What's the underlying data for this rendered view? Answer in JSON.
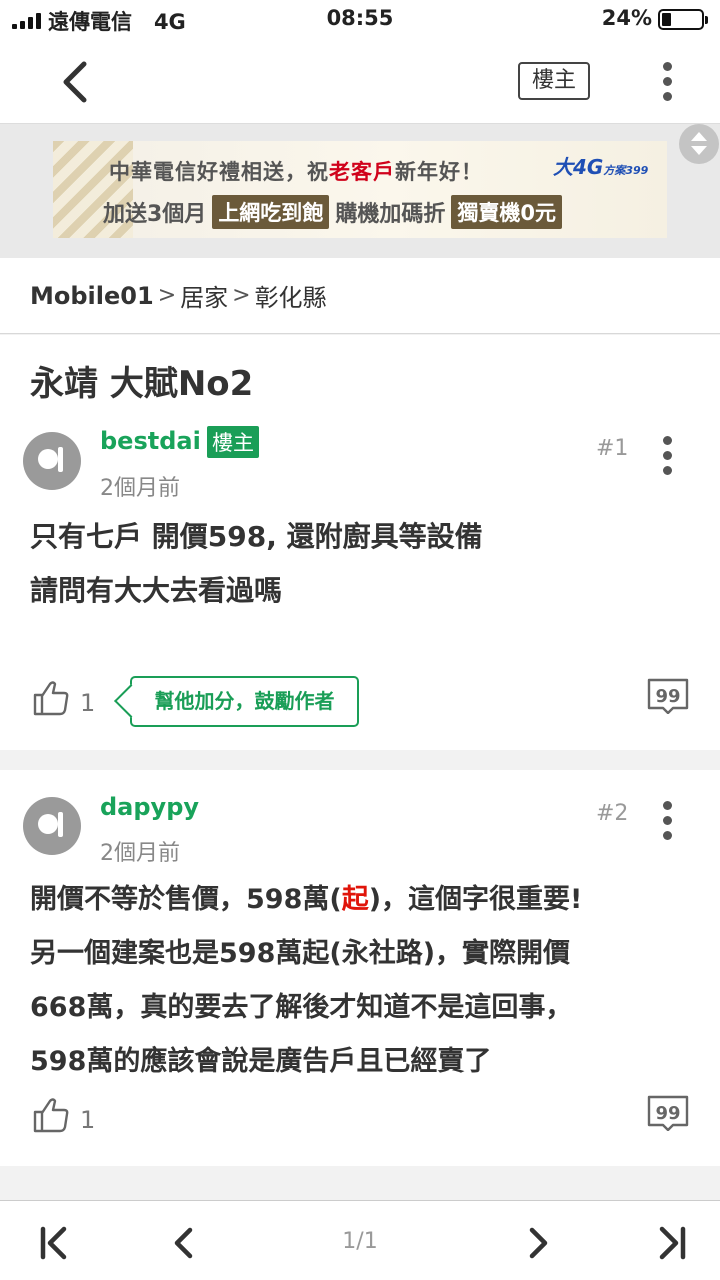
{
  "status_bar": {
    "carrier": "遠傳電信",
    "network": "4G",
    "time": "08:55",
    "battery_percent": "24%",
    "battery_level": 0.24
  },
  "nav": {
    "op_button_label": "樓主"
  },
  "ad": {
    "line1_a": "中華電信好禮相送，祝",
    "line1_red": "老客戶",
    "line1_b": "新年好！",
    "line2_a": "加送3個月",
    "line2_box1": "上網吃到飽",
    "line2_b": "購機加碼折",
    "line2_box2": "獨賣機0元",
    "brand": "大4G",
    "brand_plan": "方案399"
  },
  "breadcrumb": {
    "items": [
      "Mobile01",
      "居家",
      "彰化縣"
    ],
    "separator": ">"
  },
  "thread": {
    "title": "永靖 大賦No2"
  },
  "posts": [
    {
      "username": "bestdai",
      "op_tag": "樓主",
      "time_ago": "2個月前",
      "floor": "#1",
      "lines": [
        "只有七戶 開價598, 還附廚具等設備",
        "請問有大大去看過嗎"
      ],
      "likes": "1",
      "cheer_label": "幫他加分，鼓勵作者"
    },
    {
      "username": "dapypy",
      "time_ago": "2個月前",
      "floor": "#2",
      "line1_a": "開價不等於售價，598萬(",
      "line1_red": "起",
      "line1_b": ")，這個字很重要!",
      "lines": [
        "另一個建案也是598萬起(永社路)，實際開價",
        "668萬，真的要去了解後才知道不是這回事，",
        "598萬的應該會說是廣告戶且已經賣了"
      ],
      "likes": "1"
    }
  ],
  "pager": {
    "page_label": "1/1"
  },
  "colors": {
    "accent_green": "#1a9e57",
    "highlight_red": "#e0140a"
  }
}
